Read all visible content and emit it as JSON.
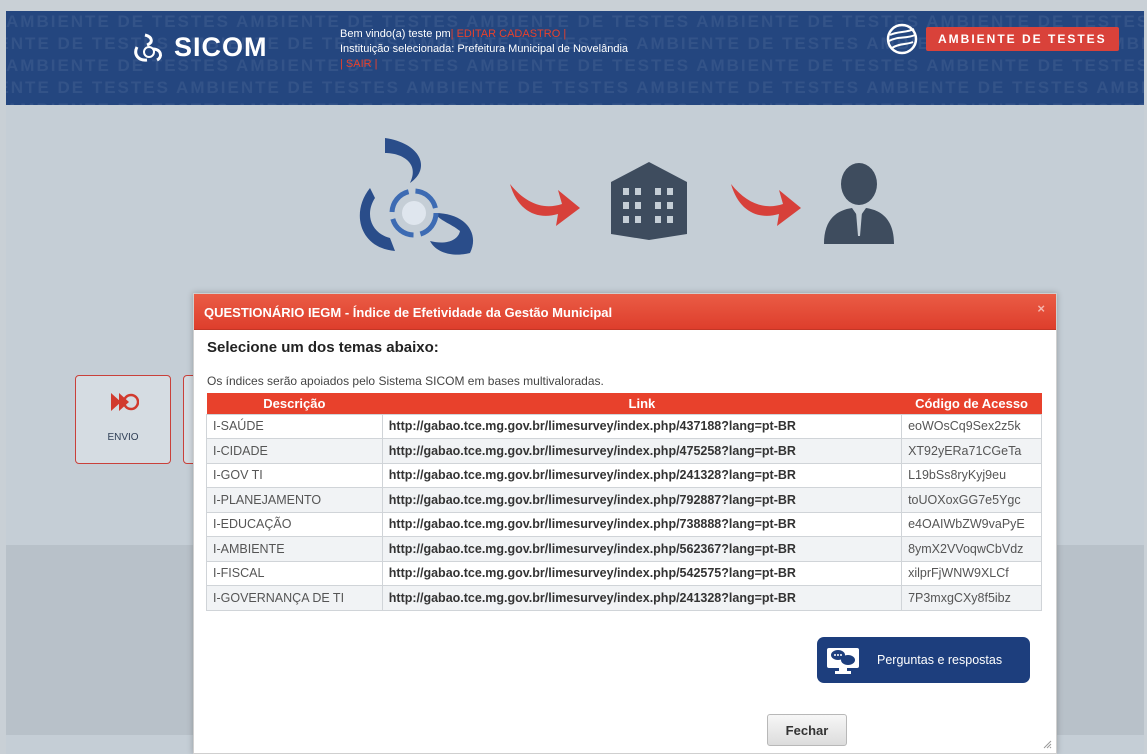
{
  "header": {
    "logo_text": "SICOM",
    "welcome_prefix": "Bem vindo(a) teste pm",
    "edit_link": "| EDITAR CADASTRO |",
    "institution": "Instituição selecionada: Prefeitura Municipal de Novelândia",
    "logout_link": "| SAIR |",
    "env_label": "AMBIENTE DE TESTES",
    "watermark": "AMBIENTE DE TESTES"
  },
  "flow": {
    "icons": [
      "sicom-logo-icon",
      "red-arrow-icon",
      "building-icon",
      "red-arrow-icon",
      "person-icon"
    ]
  },
  "side_cards": [
    {
      "label": "ENVIO",
      "icon": "upload-icon"
    }
  ],
  "modal": {
    "title": "QUESTIONÁRIO IEGM - Índice de Efetividade da Gestão Municipal",
    "close_symbol": "×",
    "subtitle": "Selecione um dos temas abaixo:",
    "note": "Os índices serão apoiados pelo Sistema SICOM em bases multivaloradas.",
    "table": {
      "headers": [
        "Descrição",
        "Link",
        "Código de Acesso"
      ],
      "rows": [
        [
          "I-SAÚDE",
          "http://gabao.tce.mg.gov.br/limesurvey/index.php/437188?lang=pt-BR",
          "eoWOsCq9Sex2z5k"
        ],
        [
          "I-CIDADE",
          "http://gabao.tce.mg.gov.br/limesurvey/index.php/475258?lang=pt-BR",
          "XT92yERa71CGeTa"
        ],
        [
          "I-GOV TI",
          "http://gabao.tce.mg.gov.br/limesurvey/index.php/241328?lang=pt-BR",
          "L19bSs8ryKyj9eu"
        ],
        [
          "I-PLANEJAMENTO",
          "http://gabao.tce.mg.gov.br/limesurvey/index.php/792887?lang=pt-BR",
          "toUOXoxGG7e5Ygc"
        ],
        [
          "I-EDUCAÇÃO",
          "http://gabao.tce.mg.gov.br/limesurvey/index.php/738888?lang=pt-BR",
          "e4OAIWbZW9vaPyE"
        ],
        [
          "I-AMBIENTE",
          "http://gabao.tce.mg.gov.br/limesurvey/index.php/562367?lang=pt-BR",
          "8ymX2VVoqwCbVdz"
        ],
        [
          "I-FISCAL",
          "http://gabao.tce.mg.gov.br/limesurvey/index.php/542575?lang=pt-BR",
          "xilprFjWNW9XLCf"
        ],
        [
          "I-GOVERNANÇA DE TI",
          "http://gabao.tce.mg.gov.br/limesurvey/index.php/241328?lang=pt-BR",
          "7P3mxgCXy8f5ibz"
        ]
      ]
    },
    "faq_button": "Perguntas e respostas",
    "close_button": "Fechar"
  },
  "colors": {
    "header_bg": "#24467f",
    "accent_red": "#e8412c",
    "faq_bg": "#1d3e7d"
  }
}
